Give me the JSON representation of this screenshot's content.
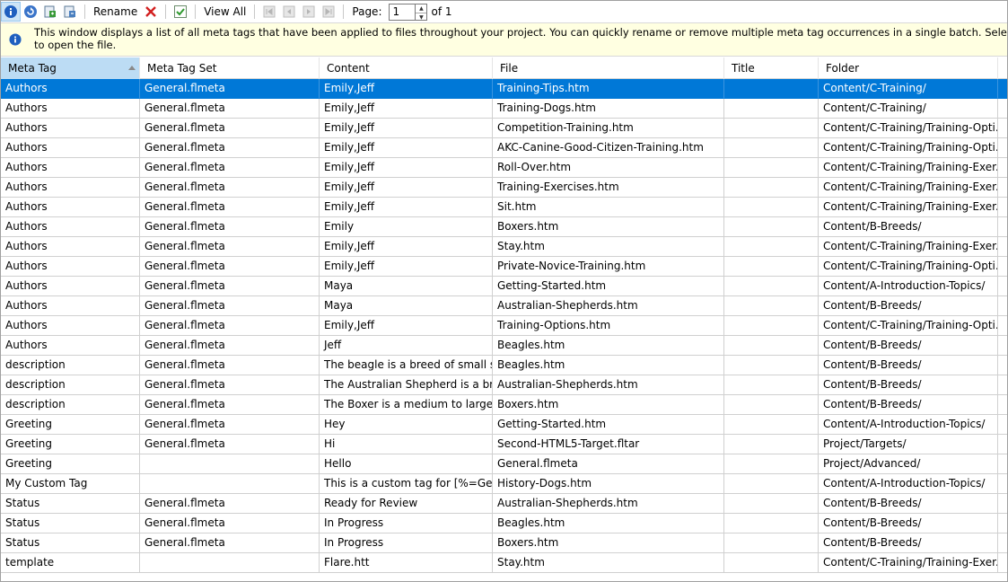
{
  "toolbar": {
    "rename_label": "Rename",
    "view_all_label": "View All",
    "page_label": "Page:",
    "page_value": "1",
    "page_of": "of 1"
  },
  "info": {
    "message_line1": "This window displays a list of all meta tags that have been applied to files throughout your project. You can quickly rename or remove multiple meta tag occurrences in a single batch. Select the rows you want",
    "message_line2": "to open the file."
  },
  "columns": [
    "Meta Tag",
    "Meta Tag Set",
    "Content",
    "File",
    "Title",
    "Folder"
  ],
  "rows": [
    {
      "tag": "Authors",
      "set": "General.flmeta",
      "content": "Emily,Jeff",
      "file": "Training-Tips.htm",
      "title": "",
      "folder": "Content/C-Training/"
    },
    {
      "tag": "Authors",
      "set": "General.flmeta",
      "content": "Emily,Jeff",
      "file": "Training-Dogs.htm",
      "title": "",
      "folder": "Content/C-Training/"
    },
    {
      "tag": "Authors",
      "set": "General.flmeta",
      "content": "Emily,Jeff",
      "file": "Competition-Training.htm",
      "title": "",
      "folder": "Content/C-Training/Training-Opti..."
    },
    {
      "tag": "Authors",
      "set": "General.flmeta",
      "content": "Emily,Jeff",
      "file": "AKC-Canine-Good-Citizen-Training.htm",
      "title": "",
      "folder": "Content/C-Training/Training-Opti..."
    },
    {
      "tag": "Authors",
      "set": "General.flmeta",
      "content": "Emily,Jeff",
      "file": "Roll-Over.htm",
      "title": "",
      "folder": "Content/C-Training/Training-Exer..."
    },
    {
      "tag": "Authors",
      "set": "General.flmeta",
      "content": "Emily,Jeff",
      "file": "Training-Exercises.htm",
      "title": "",
      "folder": "Content/C-Training/Training-Exer..."
    },
    {
      "tag": "Authors",
      "set": "General.flmeta",
      "content": "Emily,Jeff",
      "file": "Sit.htm",
      "title": "",
      "folder": "Content/C-Training/Training-Exer..."
    },
    {
      "tag": "Authors",
      "set": "General.flmeta",
      "content": "Emily",
      "file": "Boxers.htm",
      "title": "",
      "folder": "Content/B-Breeds/"
    },
    {
      "tag": "Authors",
      "set": "General.flmeta",
      "content": "Emily,Jeff",
      "file": "Stay.htm",
      "title": "",
      "folder": "Content/C-Training/Training-Exer..."
    },
    {
      "tag": "Authors",
      "set": "General.flmeta",
      "content": "Emily,Jeff",
      "file": "Private-Novice-Training.htm",
      "title": "",
      "folder": "Content/C-Training/Training-Opti..."
    },
    {
      "tag": "Authors",
      "set": "General.flmeta",
      "content": "Maya",
      "file": "Getting-Started.htm",
      "title": "",
      "folder": "Content/A-Introduction-Topics/"
    },
    {
      "tag": "Authors",
      "set": "General.flmeta",
      "content": "Maya",
      "file": "Australian-Shepherds.htm",
      "title": "",
      "folder": "Content/B-Breeds/"
    },
    {
      "tag": "Authors",
      "set": "General.flmeta",
      "content": "Emily,Jeff",
      "file": "Training-Options.htm",
      "title": "",
      "folder": "Content/C-Training/Training-Opti..."
    },
    {
      "tag": "Authors",
      "set": "General.flmeta",
      "content": "Jeff",
      "file": "Beagles.htm",
      "title": "",
      "folder": "Content/B-Breeds/"
    },
    {
      "tag": "description",
      "set": "General.flmeta",
      "content": "The beagle is a breed of small sc...",
      "file": "Beagles.htm",
      "title": "",
      "folder": "Content/B-Breeds/"
    },
    {
      "tag": "description",
      "set": "General.flmeta",
      "content": "The Australian Shepherd is a bree...",
      "file": "Australian-Shepherds.htm",
      "title": "",
      "folder": "Content/B-Breeds/"
    },
    {
      "tag": "description",
      "set": "General.flmeta",
      "content": "The Boxer is a medium to large, s...",
      "file": "Boxers.htm",
      "title": "",
      "folder": "Content/B-Breeds/"
    },
    {
      "tag": "Greeting",
      "set": "General.flmeta",
      "content": "Hey",
      "file": "Getting-Started.htm",
      "title": "",
      "folder": "Content/A-Introduction-Topics/"
    },
    {
      "tag": "Greeting",
      "set": "General.flmeta",
      "content": "Hi",
      "file": "Second-HTML5-Target.fltar",
      "title": "",
      "folder": "Project/Targets/"
    },
    {
      "tag": "Greeting",
      "set": "",
      "content": "Hello",
      "file": "General.flmeta",
      "title": "",
      "folder": "Project/Advanced/"
    },
    {
      "tag": "My Custom Tag",
      "set": "",
      "content": "This is a custom tag for [%=Gene...",
      "file": "History-Dogs.htm",
      "title": "",
      "folder": "Content/A-Introduction-Topics/"
    },
    {
      "tag": "Status",
      "set": "General.flmeta",
      "content": "Ready for Review",
      "file": "Australian-Shepherds.htm",
      "title": "",
      "folder": "Content/B-Breeds/"
    },
    {
      "tag": "Status",
      "set": "General.flmeta",
      "content": "In Progress",
      "file": "Beagles.htm",
      "title": "",
      "folder": "Content/B-Breeds/"
    },
    {
      "tag": "Status",
      "set": "General.flmeta",
      "content": "In Progress",
      "file": "Boxers.htm",
      "title": "",
      "folder": "Content/B-Breeds/"
    },
    {
      "tag": "template",
      "set": "",
      "content": "Flare.htt",
      "file": "Stay.htm",
      "title": "",
      "folder": "Content/C-Training/Training-Exer..."
    }
  ],
  "selected_row": 0,
  "icons": [
    "info-icon",
    "refresh-icon",
    "export-icon",
    "import-icon",
    "delete-icon",
    "check-icon",
    "first-page-icon",
    "prev-page-icon",
    "next-page-icon",
    "last-page-icon"
  ],
  "colors": {
    "selection": "#0078d7",
    "info_bg": "#ffffe1",
    "sorted_header": "#bcdcf4",
    "delete_red": "#d21f1f"
  }
}
